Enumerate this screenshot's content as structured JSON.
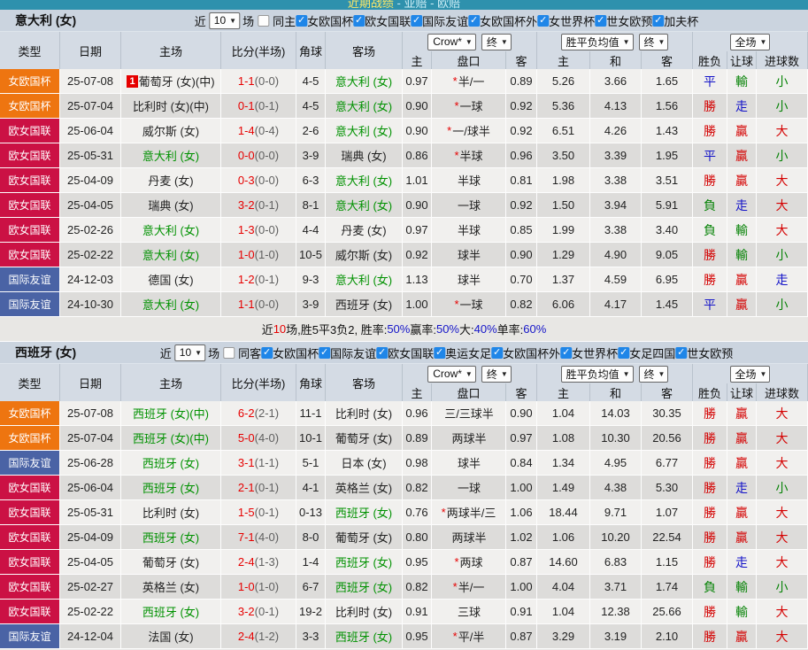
{
  "topbar": {
    "hot": "近期战绩",
    "sep1": " - ",
    "link1": "亚赔",
    "sep2": " - ",
    "link2": "欧赔"
  },
  "ui": {
    "near_label": "近",
    "games_label": "场",
    "header_cols_left": [
      "类型",
      "日期",
      "主场",
      "比分(半场)",
      "角球",
      "客场"
    ],
    "header_cols_sub": [
      "主",
      "盘口",
      "客",
      "主",
      "和",
      "客",
      "胜负",
      "让球",
      "进球数"
    ],
    "dropdowns": {
      "company": "Crow*",
      "final1": "终",
      "avg": "胜平负均值",
      "final2": "终",
      "scope": "全场"
    }
  },
  "colors": {
    "badge_orange": "#ee7510",
    "badge_crimson": "#cb1144",
    "badge_blue": "#4a63a5",
    "team_green": "#009100",
    "score_red": "#e60000",
    "result_red": "#d40000",
    "result_blue": "#1515c8",
    "result_green": "#058205"
  },
  "sections": [
    {
      "title": "意大利 (女)",
      "games": "10",
      "same_label": "同主",
      "same_checked": false,
      "competitions": [
        "女欧国杯",
        "欧女国联",
        "国际友谊",
        "女欧国杯外",
        "女世界杯",
        "世女欧预",
        "加夫杯"
      ],
      "rows": [
        {
          "type": "女欧国杯",
          "type_color": "orange",
          "date": "25-07-08",
          "home": "葡萄牙 (女)(中)",
          "home_color": "black",
          "home_badge": "1",
          "score": "1-1",
          "half": "(0-0)",
          "corner": "4-5",
          "away": "意大利 (女)",
          "away_color": "green",
          "o_home": "0.97",
          "hcp_star": "*",
          "hcp": "半/一",
          "o_away": "0.89",
          "a_home": "5.26",
          "a_draw": "3.66",
          "a_away": "1.65",
          "res": [
            [
              "平",
              "blue"
            ],
            [
              "輸",
              "green"
            ],
            [
              "小",
              "green"
            ]
          ]
        },
        {
          "type": "女欧国杯",
          "type_color": "orange",
          "date": "25-07-04",
          "home": "比利时 (女)(中)",
          "home_color": "black",
          "home_badge": "",
          "score": "0-1",
          "half": "(0-1)",
          "corner": "4-5",
          "away": "意大利 (女)",
          "away_color": "green",
          "o_home": "0.90",
          "hcp_star": "*",
          "hcp": "一球",
          "o_away": "0.92",
          "a_home": "5.36",
          "a_draw": "4.13",
          "a_away": "1.56",
          "res": [
            [
              "勝",
              "red"
            ],
            [
              "走",
              "blue"
            ],
            [
              "小",
              "green"
            ]
          ]
        },
        {
          "type": "欧女国联",
          "type_color": "crimson",
          "date": "25-06-04",
          "home": "威尔斯 (女)",
          "home_color": "black",
          "home_badge": "",
          "score": "1-4",
          "half": "(0-4)",
          "corner": "2-6",
          "away": "意大利 (女)",
          "away_color": "green",
          "o_home": "0.90",
          "hcp_star": "*",
          "hcp": "一/球半",
          "o_away": "0.92",
          "a_home": "6.51",
          "a_draw": "4.26",
          "a_away": "1.43",
          "res": [
            [
              "勝",
              "red"
            ],
            [
              "贏",
              "red"
            ],
            [
              "大",
              "red"
            ]
          ]
        },
        {
          "type": "欧女国联",
          "type_color": "crimson",
          "date": "25-05-31",
          "home": "意大利 (女)",
          "home_color": "green",
          "home_badge": "",
          "score": "0-0",
          "half": "(0-0)",
          "corner": "3-9",
          "away": "瑞典 (女)",
          "away_color": "black",
          "o_home": "0.86",
          "hcp_star": "*",
          "hcp": "半球",
          "o_away": "0.96",
          "a_home": "3.50",
          "a_draw": "3.39",
          "a_away": "1.95",
          "res": [
            [
              "平",
              "blue"
            ],
            [
              "贏",
              "red"
            ],
            [
              "小",
              "green"
            ]
          ]
        },
        {
          "type": "欧女国联",
          "type_color": "crimson",
          "date": "25-04-09",
          "home": "丹麦 (女)",
          "home_color": "black",
          "home_badge": "",
          "score": "0-3",
          "half": "(0-0)",
          "corner": "6-3",
          "away": "意大利 (女)",
          "away_color": "green",
          "o_home": "1.01",
          "hcp_star": "",
          "hcp": "半球",
          "o_away": "0.81",
          "a_home": "1.98",
          "a_draw": "3.38",
          "a_away": "3.51",
          "res": [
            [
              "勝",
              "red"
            ],
            [
              "贏",
              "red"
            ],
            [
              "大",
              "red"
            ]
          ]
        },
        {
          "type": "欧女国联",
          "type_color": "crimson",
          "date": "25-04-05",
          "home": "瑞典 (女)",
          "home_color": "black",
          "home_badge": "",
          "score": "3-2",
          "half": "(0-1)",
          "corner": "8-1",
          "away": "意大利 (女)",
          "away_color": "green",
          "o_home": "0.90",
          "hcp_star": "",
          "hcp": "一球",
          "o_away": "0.92",
          "a_home": "1.50",
          "a_draw": "3.94",
          "a_away": "5.91",
          "res": [
            [
              "負",
              "green"
            ],
            [
              "走",
              "blue"
            ],
            [
              "大",
              "red"
            ]
          ]
        },
        {
          "type": "欧女国联",
          "type_color": "crimson",
          "date": "25-02-26",
          "home": "意大利 (女)",
          "home_color": "green",
          "home_badge": "",
          "score": "1-3",
          "half": "(0-0)",
          "corner": "4-4",
          "away": "丹麦 (女)",
          "away_color": "black",
          "o_home": "0.97",
          "hcp_star": "",
          "hcp": "半球",
          "o_away": "0.85",
          "a_home": "1.99",
          "a_draw": "3.38",
          "a_away": "3.40",
          "res": [
            [
              "負",
              "green"
            ],
            [
              "輸",
              "green"
            ],
            [
              "大",
              "red"
            ]
          ]
        },
        {
          "type": "欧女国联",
          "type_color": "crimson",
          "date": "25-02-22",
          "home": "意大利 (女)",
          "home_color": "green",
          "home_badge": "",
          "score": "1-0",
          "half": "(1-0)",
          "corner": "10-5",
          "away": "威尔斯 (女)",
          "away_color": "black",
          "o_home": "0.92",
          "hcp_star": "",
          "hcp": "球半",
          "o_away": "0.90",
          "a_home": "1.29",
          "a_draw": "4.90",
          "a_away": "9.05",
          "res": [
            [
              "勝",
              "red"
            ],
            [
              "輸",
              "green"
            ],
            [
              "小",
              "green"
            ]
          ]
        },
        {
          "type": "国际友谊",
          "type_color": "blue",
          "date": "24-12-03",
          "home": "德国 (女)",
          "home_color": "black",
          "home_badge": "",
          "score": "1-2",
          "half": "(0-1)",
          "corner": "9-3",
          "away": "意大利 (女)",
          "away_color": "green",
          "o_home": "1.13",
          "hcp_star": "",
          "hcp": "球半",
          "o_away": "0.70",
          "a_home": "1.37",
          "a_draw": "4.59",
          "a_away": "6.95",
          "res": [
            [
              "勝",
              "red"
            ],
            [
              "贏",
              "red"
            ],
            [
              "走",
              "blue"
            ]
          ]
        },
        {
          "type": "国际友谊",
          "type_color": "blue",
          "date": "24-10-30",
          "home": "意大利 (女)",
          "home_color": "green",
          "home_badge": "",
          "score": "1-1",
          "half": "(0-0)",
          "corner": "3-9",
          "away": "西班牙 (女)",
          "away_color": "black",
          "o_home": "1.00",
          "hcp_star": "*",
          "hcp": "一球",
          "o_away": "0.82",
          "a_home": "6.06",
          "a_draw": "4.17",
          "a_away": "1.45",
          "res": [
            [
              "平",
              "blue"
            ],
            [
              "贏",
              "red"
            ],
            [
              "小",
              "green"
            ]
          ]
        }
      ],
      "summary": [
        {
          "text": "近",
          "color": "black"
        },
        {
          "text": "10",
          "color": "red"
        },
        {
          "text": "场,胜5平3负2, 胜率:",
          "color": "black"
        },
        {
          "text": "50%",
          "color": "blue"
        },
        {
          "text": " 赢率:",
          "color": "black"
        },
        {
          "text": "50%",
          "color": "blue"
        },
        {
          "text": " 大:",
          "color": "black"
        },
        {
          "text": "40%",
          "color": "blue"
        },
        {
          "text": " 单率:",
          "color": "black"
        },
        {
          "text": "60%",
          "color": "blue"
        }
      ]
    },
    {
      "title": "西班牙 (女)",
      "games": "10",
      "same_label": "同客",
      "same_checked": false,
      "competitions": [
        "女欧国杯",
        "国际友谊",
        "欧女国联",
        "奥运女足",
        "女欧国杯外",
        "女世界杯",
        "女足四国",
        "世女欧预"
      ],
      "rows": [
        {
          "type": "女欧国杯",
          "type_color": "orange",
          "date": "25-07-08",
          "home": "西班牙 (女)(中)",
          "home_color": "green",
          "home_badge": "",
          "score": "6-2",
          "half": "(2-1)",
          "corner": "11-1",
          "away": "比利时 (女)",
          "away_color": "black",
          "o_home": "0.96",
          "hcp_star": "",
          "hcp": "三/三球半",
          "o_away": "0.90",
          "a_home": "1.04",
          "a_draw": "14.03",
          "a_away": "30.35",
          "res": [
            [
              "勝",
              "red"
            ],
            [
              "贏",
              "red"
            ],
            [
              "大",
              "red"
            ]
          ]
        },
        {
          "type": "女欧国杯",
          "type_color": "orange",
          "date": "25-07-04",
          "home": "西班牙 (女)(中)",
          "home_color": "green",
          "home_badge": "",
          "score": "5-0",
          "half": "(4-0)",
          "corner": "10-1",
          "away": "葡萄牙 (女)",
          "away_color": "black",
          "o_home": "0.89",
          "hcp_star": "",
          "hcp": "两球半",
          "o_away": "0.97",
          "a_home": "1.08",
          "a_draw": "10.30",
          "a_away": "20.56",
          "res": [
            [
              "勝",
              "red"
            ],
            [
              "贏",
              "red"
            ],
            [
              "大",
              "red"
            ]
          ]
        },
        {
          "type": "国际友谊",
          "type_color": "blue",
          "date": "25-06-28",
          "home": "西班牙 (女)",
          "home_color": "green",
          "home_badge": "",
          "score": "3-1",
          "half": "(1-1)",
          "corner": "5-1",
          "away": "日本 (女)",
          "away_color": "black",
          "o_home": "0.98",
          "hcp_star": "",
          "hcp": "球半",
          "o_away": "0.84",
          "a_home": "1.34",
          "a_draw": "4.95",
          "a_away": "6.77",
          "res": [
            [
              "勝",
              "red"
            ],
            [
              "贏",
              "red"
            ],
            [
              "大",
              "red"
            ]
          ]
        },
        {
          "type": "欧女国联",
          "type_color": "crimson",
          "date": "25-06-04",
          "home": "西班牙 (女)",
          "home_color": "green",
          "home_badge": "",
          "score": "2-1",
          "half": "(0-1)",
          "corner": "4-1",
          "away": "英格兰 (女)",
          "away_color": "black",
          "o_home": "0.82",
          "hcp_star": "",
          "hcp": "一球",
          "o_away": "1.00",
          "a_home": "1.49",
          "a_draw": "4.38",
          "a_away": "5.30",
          "res": [
            [
              "勝",
              "red"
            ],
            [
              "走",
              "blue"
            ],
            [
              "小",
              "green"
            ]
          ]
        },
        {
          "type": "欧女国联",
          "type_color": "crimson",
          "date": "25-05-31",
          "home": "比利时 (女)",
          "home_color": "black",
          "home_badge": "",
          "score": "1-5",
          "half": "(0-1)",
          "corner": "0-13",
          "away": "西班牙 (女)",
          "away_color": "green",
          "o_home": "0.76",
          "hcp_star": "*",
          "hcp": "两球半/三",
          "o_away": "1.06",
          "a_home": "18.44",
          "a_draw": "9.71",
          "a_away": "1.07",
          "res": [
            [
              "勝",
              "red"
            ],
            [
              "贏",
              "red"
            ],
            [
              "大",
              "red"
            ]
          ]
        },
        {
          "type": "欧女国联",
          "type_color": "crimson",
          "date": "25-04-09",
          "home": "西班牙 (女)",
          "home_color": "green",
          "home_badge": "",
          "score": "7-1",
          "half": "(4-0)",
          "corner": "8-0",
          "away": "葡萄牙 (女)",
          "away_color": "black",
          "o_home": "0.80",
          "hcp_star": "",
          "hcp": "两球半",
          "o_away": "1.02",
          "a_home": "1.06",
          "a_draw": "10.20",
          "a_away": "22.54",
          "res": [
            [
              "勝",
              "red"
            ],
            [
              "贏",
              "red"
            ],
            [
              "大",
              "red"
            ]
          ]
        },
        {
          "type": "欧女国联",
          "type_color": "crimson",
          "date": "25-04-05",
          "home": "葡萄牙 (女)",
          "home_color": "black",
          "home_badge": "",
          "score": "2-4",
          "half": "(1-3)",
          "corner": "1-4",
          "away": "西班牙 (女)",
          "away_color": "green",
          "o_home": "0.95",
          "hcp_star": "*",
          "hcp": "两球",
          "o_away": "0.87",
          "a_home": "14.60",
          "a_draw": "6.83",
          "a_away": "1.15",
          "res": [
            [
              "勝",
              "red"
            ],
            [
              "走",
              "blue"
            ],
            [
              "大",
              "red"
            ]
          ]
        },
        {
          "type": "欧女国联",
          "type_color": "crimson",
          "date": "25-02-27",
          "home": "英格兰 (女)",
          "home_color": "black",
          "home_badge": "",
          "score": "1-0",
          "half": "(1-0)",
          "corner": "6-7",
          "away": "西班牙 (女)",
          "away_color": "green",
          "o_home": "0.82",
          "hcp_star": "*",
          "hcp": "半/一",
          "o_away": "1.00",
          "a_home": "4.04",
          "a_draw": "3.71",
          "a_away": "1.74",
          "res": [
            [
              "負",
              "green"
            ],
            [
              "輸",
              "green"
            ],
            [
              "小",
              "green"
            ]
          ]
        },
        {
          "type": "欧女国联",
          "type_color": "crimson",
          "date": "25-02-22",
          "home": "西班牙 (女)",
          "home_color": "green",
          "home_badge": "",
          "score": "3-2",
          "half": "(0-1)",
          "corner": "19-2",
          "away": "比利时 (女)",
          "away_color": "black",
          "o_home": "0.91",
          "hcp_star": "",
          "hcp": "三球",
          "o_away": "0.91",
          "a_home": "1.04",
          "a_draw": "12.38",
          "a_away": "25.66",
          "res": [
            [
              "勝",
              "red"
            ],
            [
              "輸",
              "green"
            ],
            [
              "大",
              "red"
            ]
          ]
        },
        {
          "type": "国际友谊",
          "type_color": "blue",
          "date": "24-12-04",
          "home": "法国 (女)",
          "home_color": "black",
          "home_badge": "",
          "score": "2-4",
          "half": "(1-2)",
          "corner": "3-3",
          "away": "西班牙 (女)",
          "away_color": "green",
          "o_home": "0.95",
          "hcp_star": "*",
          "hcp": "平/半",
          "o_away": "0.87",
          "a_home": "3.29",
          "a_draw": "3.19",
          "a_away": "2.10",
          "res": [
            [
              "勝",
              "red"
            ],
            [
              "贏",
              "red"
            ],
            [
              "大",
              "red"
            ]
          ]
        }
      ],
      "summary": []
    }
  ]
}
